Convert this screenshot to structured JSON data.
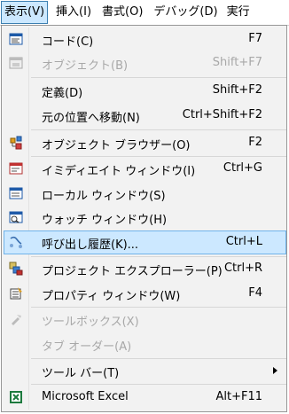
{
  "menubar": {
    "items": [
      {
        "label": "表示(V)",
        "active": true
      },
      {
        "label": "挿入(I)"
      },
      {
        "label": "書式(O)"
      },
      {
        "label": "デバッグ(D)"
      },
      {
        "label": "実行"
      }
    ]
  },
  "menu": {
    "items": [
      {
        "label": "コード(C)",
        "shortcut": "F7",
        "icon": "code-window-icon"
      },
      {
        "label": "オブジェクト(B)",
        "shortcut": "Shift+F7",
        "icon": "object-window-icon",
        "disabled": true
      },
      {
        "label": "定義(D)",
        "shortcut": "Shift+F2"
      },
      {
        "label": "元の位置へ移動(N)",
        "shortcut": "Ctrl+Shift+F2"
      },
      {
        "label": "オブジェクト ブラウザー(O)",
        "shortcut": "F2",
        "icon": "object-browser-icon"
      },
      {
        "label": "イミディエイト ウィンドウ(I)",
        "shortcut": "Ctrl+G",
        "icon": "immediate-window-icon"
      },
      {
        "label": "ローカル ウィンドウ(S)",
        "shortcut": "",
        "icon": "locals-window-icon"
      },
      {
        "label": "ウォッチ ウィンドウ(H)",
        "shortcut": "",
        "icon": "watch-window-icon"
      },
      {
        "label": "呼び出し履歴(K)...",
        "shortcut": "Ctrl+L",
        "icon": "call-stack-icon",
        "highlighted": true
      },
      {
        "label": "プロジェクト エクスプローラー(P)",
        "shortcut": "Ctrl+R",
        "icon": "project-explorer-icon"
      },
      {
        "label": "プロパティ ウィンドウ(W)",
        "shortcut": "F4",
        "icon": "properties-window-icon"
      },
      {
        "label": "ツールボックス(X)",
        "shortcut": "",
        "icon": "toolbox-icon",
        "disabled": true
      },
      {
        "label": "タブ オーダー(A)",
        "shortcut": "",
        "disabled": true
      },
      {
        "label": "ツール バー(T)",
        "shortcut": "",
        "submenu": true
      },
      {
        "label": "Microsoft Excel",
        "shortcut": "Alt+F11",
        "icon": "excel-icon"
      }
    ]
  }
}
